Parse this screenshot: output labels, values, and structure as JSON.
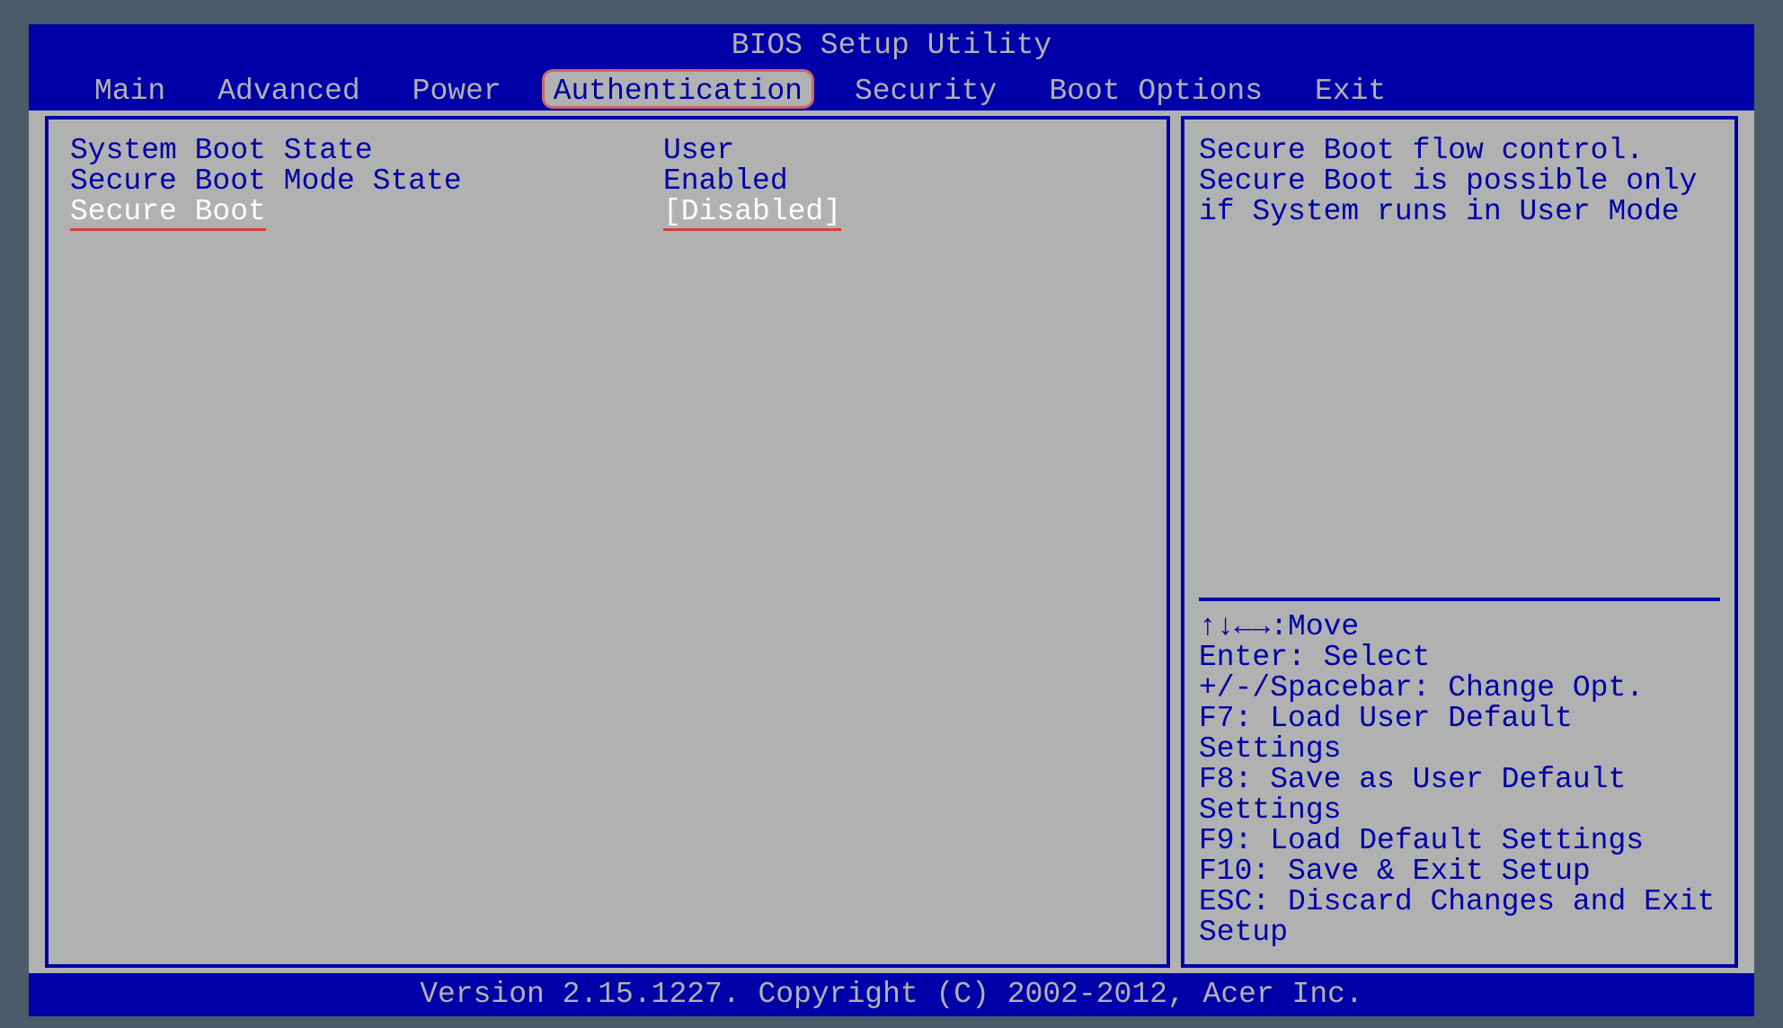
{
  "title": "BIOS Setup Utility",
  "tabs": [
    {
      "label": "Main"
    },
    {
      "label": "Advanced"
    },
    {
      "label": "Power"
    },
    {
      "label": "Authentication"
    },
    {
      "label": "Security"
    },
    {
      "label": "Boot Options"
    },
    {
      "label": "Exit"
    }
  ],
  "active_tab_index": 3,
  "settings": [
    {
      "label": "System Boot State",
      "value": "User",
      "selected": false,
      "editable": false
    },
    {
      "label": "Secure Boot Mode State",
      "value": "Enabled",
      "selected": false,
      "editable": false
    },
    {
      "label": "Secure Boot",
      "value": "[Disabled]",
      "selected": true,
      "editable": true
    }
  ],
  "help": {
    "text": "Secure Boot flow control. Secure Boot is possible only if System runs in User Mode"
  },
  "keys": [
    "↑↓←→:Move",
    "Enter: Select",
    "+/-/Spacebar: Change Opt.",
    "F7: Load User Default Settings",
    "F8: Save as User Default Settings",
    "F9: Load Default Settings",
    "F10: Save & Exit Setup",
    "ESC: Discard Changes and Exit Setup"
  ],
  "footer": "Version 2.15.1227. Copyright (C) 2002-2012, Acer Inc."
}
